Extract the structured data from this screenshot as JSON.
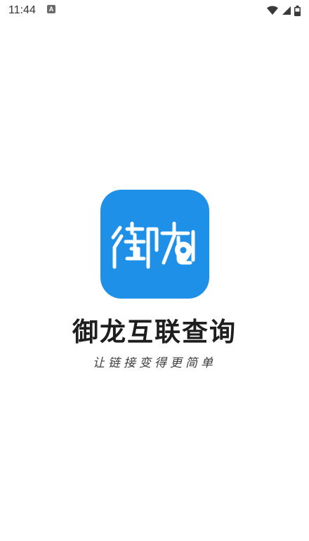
{
  "status_bar": {
    "time": "11:44",
    "notification_icon_text": "A",
    "icons": [
      "notification-icon",
      "wifi-icon",
      "signal-icon",
      "battery-icon"
    ]
  },
  "logo": {
    "icon_name": "yulong-logo",
    "background_color": "#1e90e8"
  },
  "app": {
    "name": "御龙互联查询",
    "slogan": "让链接变得更简单"
  }
}
